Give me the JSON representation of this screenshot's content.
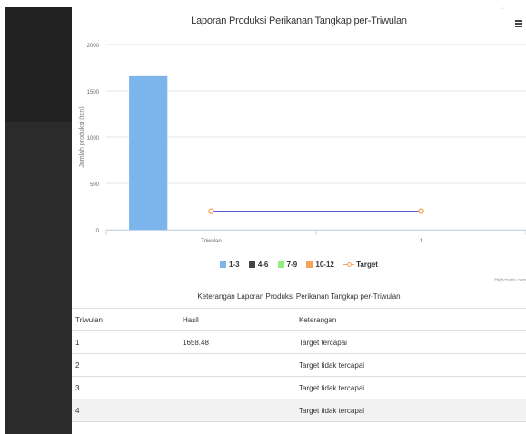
{
  "chart_data": {
    "type": "bar",
    "title": "Laporan Produksi Perikanan Tangkap per-Triwulan",
    "ylabel": "Jumlah produksi (ton)",
    "xlabel": "",
    "categories": [
      "Triwulan",
      "1"
    ],
    "ylim": [
      0,
      2000
    ],
    "yticks": [
      "0",
      "500",
      "1000",
      "1500",
      "2000"
    ],
    "grid": true,
    "legend_position": "bottom",
    "series": [
      {
        "name": "1-3",
        "type": "bar",
        "color": "#7cb5ec",
        "values": [
          1658.48,
          null
        ]
      },
      {
        "name": "4-6",
        "type": "bar",
        "color": "#434348",
        "values": [
          null,
          null
        ]
      },
      {
        "name": "7-9",
        "type": "bar",
        "color": "#90ed7d",
        "values": [
          null,
          null
        ]
      },
      {
        "name": "10-12",
        "type": "bar",
        "color": "#f7a35c",
        "values": [
          null,
          null
        ]
      },
      {
        "name": "Target",
        "type": "line",
        "color": "#f7a35c",
        "line_color": "#5b5bd6",
        "values": [
          200,
          200
        ]
      }
    ]
  },
  "legend": {
    "items": [
      "1-3",
      "4-6",
      "7-9",
      "10-12",
      "Target"
    ],
    "colors": [
      "#7cb5ec",
      "#434348",
      "#90ed7d",
      "#f7a35c",
      "#f7a35c"
    ]
  },
  "credits": "Highcharts.com",
  "table": {
    "caption": "Keterangan Laporan Produksi Perikanan Tangkap per-Triwulan",
    "headers": [
      "Triwulan",
      "Hasil",
      "Keterangan"
    ],
    "rows": [
      [
        "1",
        "1658.48",
        "Target tercapai"
      ],
      [
        "2",
        "",
        "Target tidak tercapai"
      ],
      [
        "3",
        "",
        "Target tidak tercapai"
      ],
      [
        "4",
        "",
        "Target tidak tercapai"
      ]
    ]
  },
  "icons": {
    "menu": "hamburger-menu-icon"
  }
}
